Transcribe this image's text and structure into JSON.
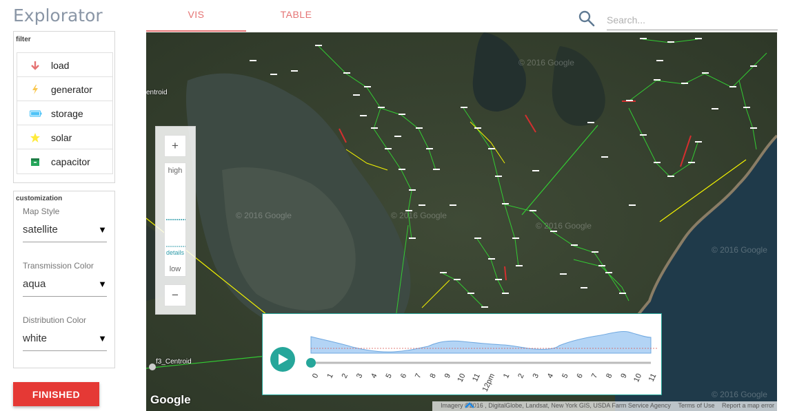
{
  "app": {
    "title": "Explorator"
  },
  "tabs": [
    {
      "label": "VIS",
      "active": true
    },
    {
      "label": "TABLE",
      "active": false
    }
  ],
  "search": {
    "placeholder": "Search..."
  },
  "filter": {
    "title": "filter",
    "items": [
      {
        "label": "load",
        "icon": "arrow-down-icon",
        "color": "#e57373"
      },
      {
        "label": "generator",
        "icon": "lightning-icon",
        "color": "#f9c74f"
      },
      {
        "label": "storage",
        "icon": "battery-icon",
        "color": "#4fc3f7"
      },
      {
        "label": "solar",
        "icon": "star-icon",
        "color": "#ffeb3b"
      },
      {
        "label": "capacitor",
        "icon": "capacitor-icon",
        "color": "#26a65b"
      }
    ]
  },
  "customization": {
    "title": "customization",
    "map_style": {
      "label": "Map Style",
      "value": "satellite"
    },
    "transmission_color": {
      "label": "Transmission Color",
      "value": "aqua"
    },
    "distribution_color": {
      "label": "Distribution Color",
      "value": "white"
    }
  },
  "finished_button": "FINISHED",
  "map": {
    "labels": {
      "centroid_top": "entroid",
      "centroid_bottom": "f3_Centroid"
    },
    "watermark": "© 2016 Google",
    "google": "Google",
    "attribution": {
      "imagery": "Imagery ©2016 , DigitalGlobe, Landsat, New York GIS, USDA Farm Service Agency",
      "terms": "Terms of Use",
      "report": "Report a map error"
    },
    "zoom": {
      "plus": "+",
      "minus": "−",
      "high": "high",
      "low": "low",
      "details": "details"
    }
  },
  "timeline": {
    "hours": [
      "0",
      "1",
      "2",
      "3",
      "4",
      "5",
      "6",
      "7",
      "8",
      "9",
      "10",
      "11",
      "12pm",
      "1",
      "2",
      "3",
      "4",
      "5",
      "6",
      "7",
      "8",
      "9",
      "10",
      "11"
    ],
    "current_hour_index": 0,
    "accent": "#26a69a"
  }
}
